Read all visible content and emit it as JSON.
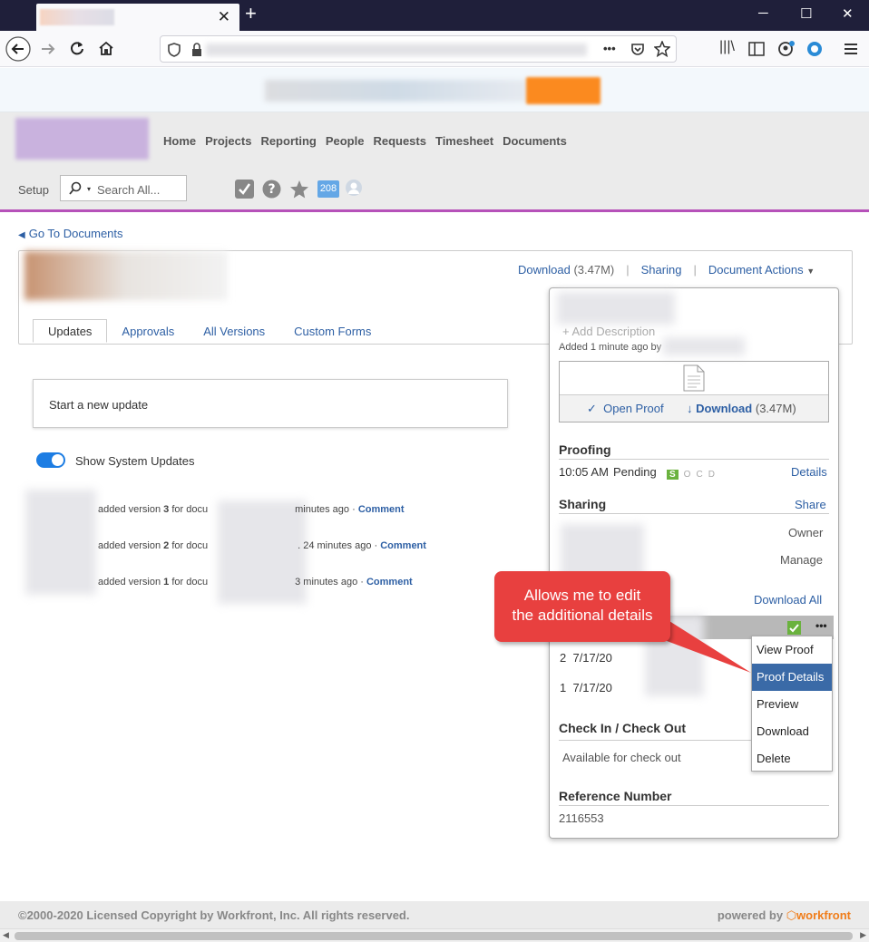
{
  "browser": {
    "new_tab": "+",
    "win_min": "─",
    "win_max": "☐",
    "win_close": "✕",
    "more": "•••"
  },
  "nav": {
    "items": [
      "Home",
      "Projects",
      "Reporting",
      "People",
      "Requests",
      "Timesheet",
      "Documents"
    ],
    "setup": "Setup",
    "search_placeholder": "Search All...",
    "badge_count": "208"
  },
  "content": {
    "go_to": "Go To Documents",
    "download_label": "Download",
    "download_size": "(3.47M)",
    "sharing": "Sharing",
    "document_actions": "Document Actions",
    "tabs": [
      "Updates",
      "Approvals",
      "All Versions",
      "Custom Forms"
    ],
    "new_update": "Start a new update",
    "show_system": "Show System Updates",
    "feed": [
      {
        "pre": "added version ",
        "ver": "3",
        "mid": " for docu",
        "time": "minutes ago · ",
        "link": "Comment"
      },
      {
        "pre": "added version ",
        "ver": "2",
        "mid": " for docu",
        "time": ". 24 minutes ago · ",
        "link": "Comment"
      },
      {
        "pre": "added version ",
        "ver": "1",
        "mid": " for docu",
        "time": "3 minutes ago · ",
        "link": "Comment"
      }
    ]
  },
  "popover": {
    "add_description": "+ Add Description",
    "added": "Added 1 minute ago by",
    "open_proof": "Open Proof",
    "download": "Download",
    "download_size": "(3.47M)",
    "proofing": "Proofing",
    "proof_time": "10:05 AM",
    "proof_status": "Pending",
    "status_letters": [
      "S",
      "O",
      "C",
      "D"
    ],
    "details": "Details",
    "sharing": "Sharing",
    "share": "Share",
    "owner": "Owner",
    "manage": "Manage",
    "download_all": "Download All",
    "versions": [
      {
        "num": "2",
        "date": "7/17/20"
      },
      {
        "num": "1",
        "date": "7/17/20"
      }
    ],
    "checkin": "Check In / Check Out",
    "available": "Available for check out",
    "ref_label": "Reference Number",
    "ref_value": "2116553"
  },
  "menu": {
    "items": [
      "View Proof",
      "Proof Details",
      "Preview",
      "Download",
      "Delete"
    ],
    "selected": 1
  },
  "callout": {
    "line1": "Allows me to edit",
    "line2": "the additional details"
  },
  "footer": {
    "copyright": "©2000-2020 Licensed Copyright by Workfront, Inc. All rights reserved.",
    "powered": "powered by",
    "brand": "workfront"
  }
}
